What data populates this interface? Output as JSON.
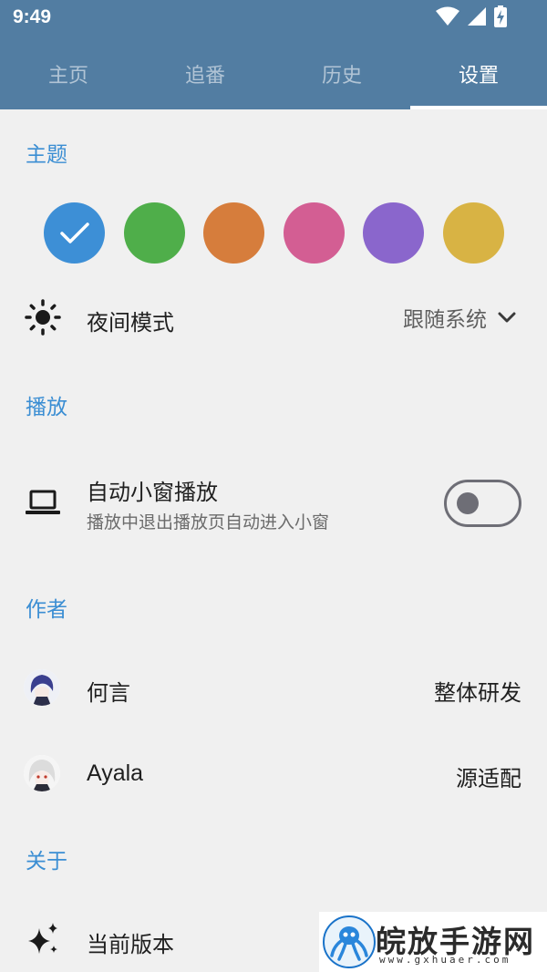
{
  "status_bar": {
    "time": "9:49",
    "icons": [
      "wifi-icon",
      "cellular-signal-icon",
      "battery-charging-icon"
    ]
  },
  "tabs": [
    {
      "label": "主页",
      "active": false
    },
    {
      "label": "追番",
      "active": false
    },
    {
      "label": "历史",
      "active": false
    },
    {
      "label": "设置",
      "active": true
    }
  ],
  "colors": {
    "header": "#527da2",
    "accent": "#3b8ed3",
    "background": "#f0f0f0"
  },
  "theme": {
    "title": "主题",
    "swatches": [
      {
        "color": "#3d8fd6",
        "selected": true
      },
      {
        "color": "#4fae4a",
        "selected": false
      },
      {
        "color": "#d67d3c",
        "selected": false
      },
      {
        "color": "#d35e93",
        "selected": false
      },
      {
        "color": "#8a66cc",
        "selected": false
      },
      {
        "color": "#d8b344",
        "selected": false
      }
    ],
    "night_mode": {
      "icon": "sun-icon",
      "label": "夜间模式",
      "value": "跟随系统"
    }
  },
  "playback": {
    "title": "播放",
    "auto_pip": {
      "icon": "laptop-icon",
      "label": "自动小窗播放",
      "description": "播放中退出播放页自动进入小窗",
      "enabled": false
    }
  },
  "authors": {
    "title": "作者",
    "items": [
      {
        "name": "何言",
        "role": "整体研发"
      },
      {
        "name": "Ayala",
        "role": "源适配"
      }
    ]
  },
  "about": {
    "title": "关于",
    "version": {
      "icon": "sparkle-icon",
      "label": "当前版本"
    }
  },
  "watermark": {
    "title": "皖放手游网",
    "url": "www.gxhuaer.com"
  }
}
